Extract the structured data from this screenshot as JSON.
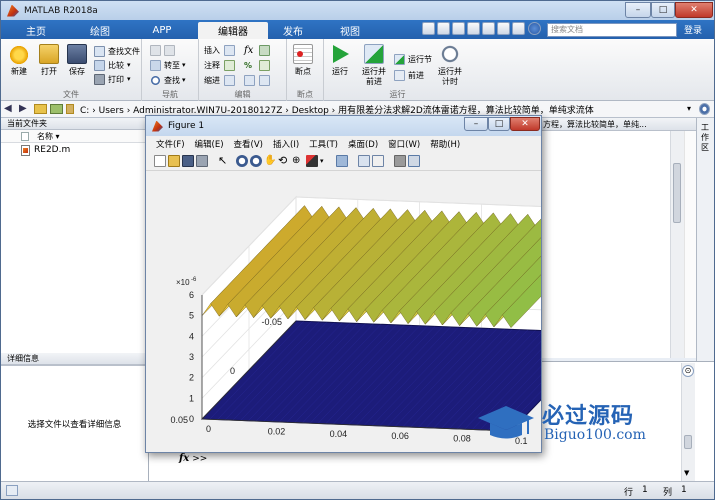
{
  "window": {
    "title": "MATLAB R2018a",
    "controls": [
      "–",
      "□",
      "✕"
    ]
  },
  "tabs": [
    "主页",
    "绘图",
    "APP",
    "编辑器",
    "发布",
    "视图"
  ],
  "search": {
    "placeholder": "搜索文档"
  },
  "collapse_label": "登录",
  "ribbon": {
    "file": {
      "label": "文件",
      "new": "新建",
      "open": "打开",
      "save": "保存",
      "find_files": "查找文件",
      "compare": "比较",
      "print": "打印"
    },
    "navigate": {
      "label": "导航",
      "goto": "转至",
      "find": "查找"
    },
    "edit": {
      "label": "编辑",
      "insert": "插入",
      "comment": "注释",
      "indent": "缩进",
      "fx": "fx"
    },
    "breakpoints": {
      "label": "断点",
      "breakpoints": "断点"
    },
    "run": {
      "label": "运行",
      "run": "运行",
      "run_advance": "运行并\n前进",
      "run_section": "运行节",
      "advance": "前进",
      "run_time": "运行并\n计时"
    }
  },
  "address": {
    "path": "C: › Users › Administrator.WIN7U-20180127Z › Desktop › 用有限差分法求解2D流体雷诺方程，算法比较简单，单纯求流体"
  },
  "current_folder": {
    "header": "当前文件夹",
    "column_name": "名称 ▾",
    "files": [
      "RE2D.m"
    ]
  },
  "details": {
    "header": "详细信息",
    "empty_text": "选择文件以查看详细信息"
  },
  "editor": {
    "tab_text": "方程，算法比较简单，单纯..."
  },
  "workspace": {
    "label": "工作区"
  },
  "command": {
    "prompt": "fx",
    "chevrons": ">>"
  },
  "status": {
    "row_label": "行",
    "row_value": "1",
    "col_label": "列",
    "col_value": "1"
  },
  "figure": {
    "title": "Figure 1",
    "menu": [
      "文件(F)",
      "编辑(E)",
      "查看(V)",
      "插入(I)",
      "工具(T)",
      "桌面(D)",
      "窗口(W)",
      "帮助(H)"
    ],
    "controls": [
      "–",
      "□",
      "✕"
    ]
  },
  "watermark": {
    "brand": "必过源码",
    "site": "Biguo100.com"
  },
  "colors": {
    "matlab_blue": "#2461ad",
    "surface_yellow": "#f2d23a",
    "surface_navy": "#1c1c7a"
  },
  "chart_data": {
    "type": "surface",
    "exponent_label": "×10",
    "exponent_power": "-6",
    "z_ticks": [
      "0",
      "1",
      "2",
      "3",
      "4",
      "5",
      "6"
    ],
    "zlim": [
      0,
      6
    ],
    "x_ticks": [
      "0.05",
      "0",
      "-0.05"
    ],
    "xlim": [
      -0.05,
      0.05
    ],
    "y_ticks": [
      "0",
      "0.02",
      "0.04",
      "0.06",
      "0.08",
      "0.1"
    ],
    "ylim": [
      0,
      0.1
    ],
    "surfaces": [
      {
        "level": 5.0,
        "ridge_count": 18,
        "ridge_amplitude": 0.6
      },
      {
        "level": 0.0,
        "ridge_count": 0,
        "ridge_amplitude": 0
      }
    ],
    "grid": true
  }
}
